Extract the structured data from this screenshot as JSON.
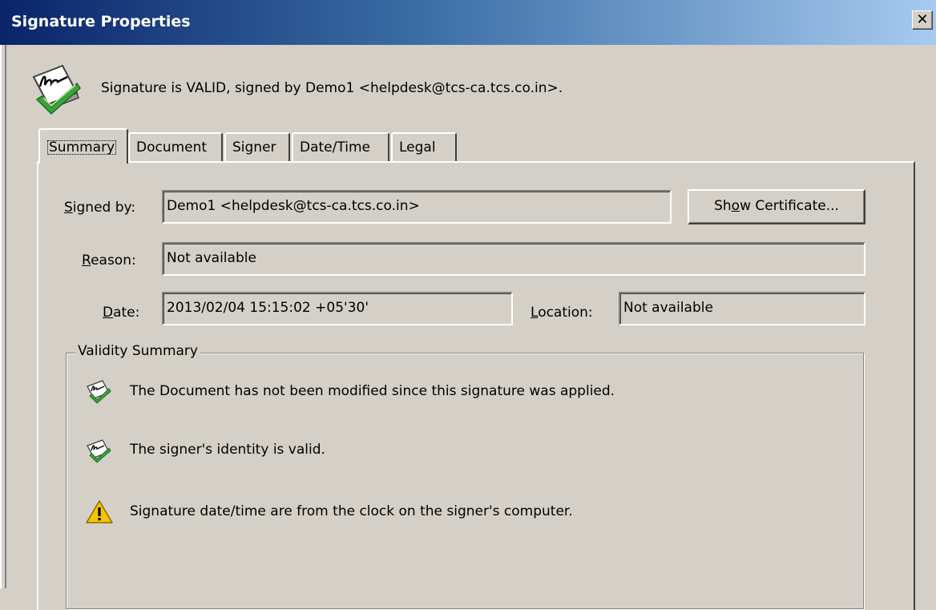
{
  "window": {
    "title": "Signature Properties",
    "close_label": "✕"
  },
  "status": {
    "message": "Signature is VALID, signed by Demo1 <helpdesk@tcs-ca.tcs.co.in>."
  },
  "tabs": [
    {
      "label": "Summary",
      "active": true
    },
    {
      "label": "Document",
      "active": false
    },
    {
      "label": "Signer",
      "active": false
    },
    {
      "label": "Date/Time",
      "active": false
    },
    {
      "label": "Legal",
      "active": false
    }
  ],
  "summary": {
    "signed_by_label_pre": "",
    "signed_by_label_key": "S",
    "signed_by_label_post": "igned by:",
    "signed_by_value": "Demo1 <helpdesk@tcs-ca.tcs.co.in>",
    "show_certificate_pre": "Sh",
    "show_certificate_key": "o",
    "show_certificate_post": "w Certificate...",
    "reason_label_key": "R",
    "reason_label_post": "eason:",
    "reason_value": "Not available",
    "date_label_key": "D",
    "date_label_post": "ate:",
    "date_value": "2013/02/04 15:15:02 +05'30'",
    "location_label_key": "L",
    "location_label_post": "ocation:",
    "location_value": "Not available"
  },
  "validity": {
    "title": "Validity Summary",
    "items": [
      {
        "icon": "signature-valid-icon",
        "text": "The Document has not been modified since this signature was applied."
      },
      {
        "icon": "signature-valid-icon",
        "text": "The signer's identity is valid."
      },
      {
        "icon": "warning-icon",
        "text": "Signature date/time are from the clock on the signer's computer."
      }
    ]
  },
  "colors": {
    "titlebar_start": "#0a246a",
    "titlebar_end": "#a6caf0",
    "dialog_bg": "#d4d0c8",
    "check_green": "#3aa43a",
    "warning_yellow": "#f5c400"
  }
}
